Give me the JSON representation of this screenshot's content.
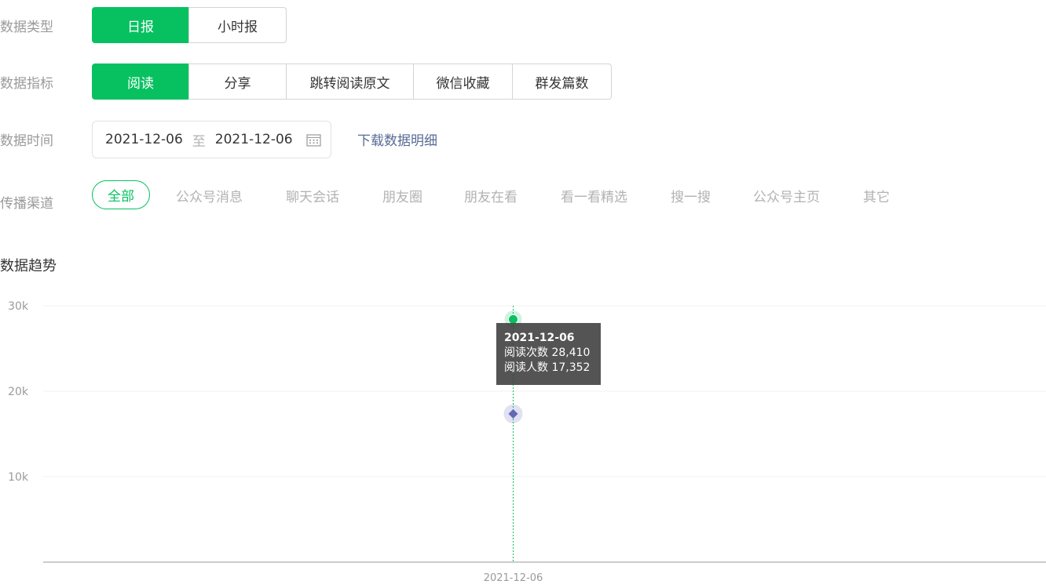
{
  "filters": {
    "type": {
      "label": "数据类型",
      "options": [
        "日报",
        "小时报"
      ],
      "active_index": 0
    },
    "metric": {
      "label": "数据指标",
      "options": [
        "阅读",
        "分享",
        "跳转阅读原文",
        "微信收藏",
        "群发篇数"
      ],
      "active_index": 0
    },
    "time": {
      "label": "数据时间",
      "start": "2021-12-06",
      "separator": "至",
      "end": "2021-12-06",
      "download_link": "下载数据明细"
    },
    "channel": {
      "label": "传播渠道",
      "options": [
        "全部",
        "公众号消息",
        "聊天会话",
        "朋友圈",
        "朋友在看",
        "看一看精选",
        "搜一搜",
        "公众号主页",
        "其它"
      ],
      "active_index": 0
    }
  },
  "trend": {
    "title": "数据趋势"
  },
  "tooltip": {
    "date": "2021-12-06",
    "lines": [
      "阅读次数 28,410",
      "阅读人数 17,352"
    ]
  },
  "chart_data": {
    "type": "line",
    "x": [
      "2021-12-06"
    ],
    "series": [
      {
        "values": [
          28410
        ],
        "color": "#07c160",
        "marker": "circle"
      },
      {
        "values": [
          17352
        ],
        "color": "#6467b9",
        "marker": "diamond"
      }
    ],
    "y_ticks": [
      "10k",
      "20k",
      "30k"
    ],
    "ylim": [
      0,
      30000
    ],
    "grid": true,
    "colors": {
      "crosshair": "#07c160",
      "grid": "#f0f0f0",
      "axis": "#cccccc"
    }
  }
}
